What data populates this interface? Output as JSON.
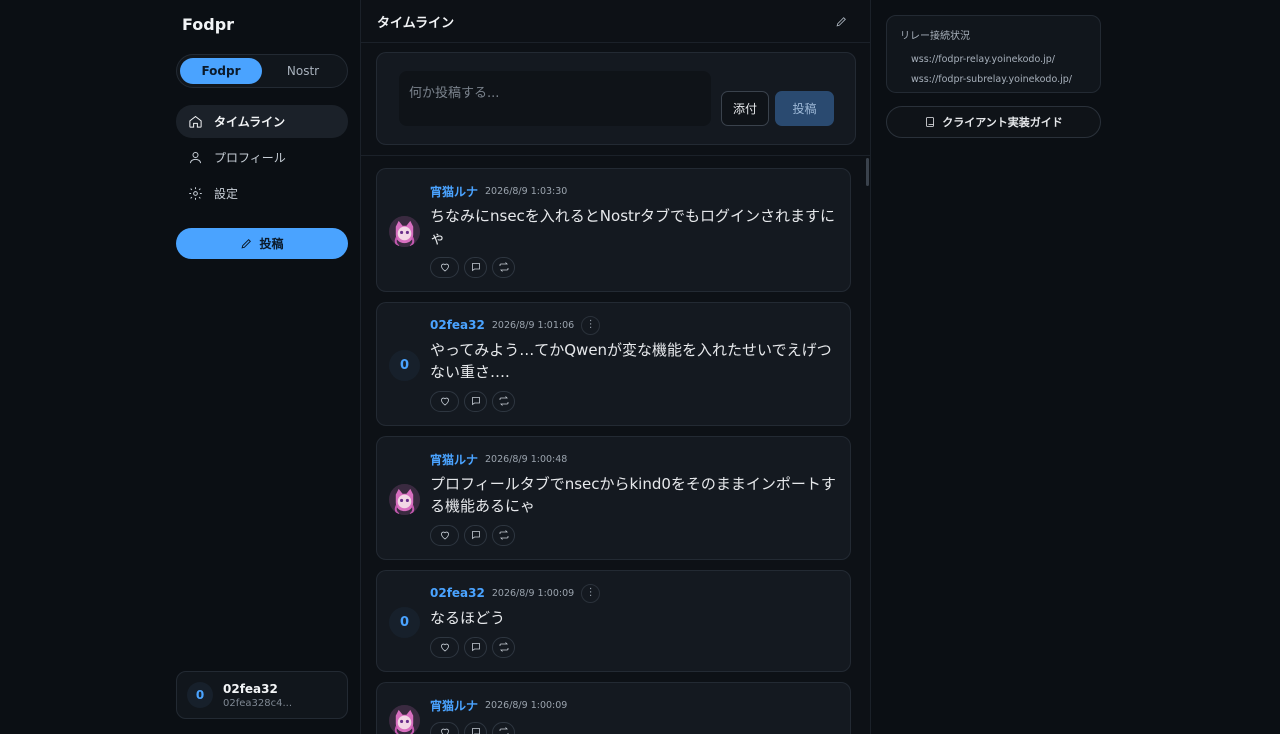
{
  "app": {
    "logo": "Fodpr"
  },
  "segments": [
    {
      "label": "Fodpr",
      "active": true
    },
    {
      "label": "Nostr",
      "active": false
    }
  ],
  "nav": [
    {
      "label": "タイムライン",
      "icon": "home-icon",
      "active": true
    },
    {
      "label": "プロフィール",
      "icon": "user-icon",
      "active": false
    },
    {
      "label": "設定",
      "icon": "gear-icon",
      "active": false
    }
  ],
  "post_button": {
    "label": "投稿",
    "icon": "pencil-icon"
  },
  "account": {
    "avatar_initial": "0",
    "name": "02fea32",
    "npub": "02fea328c4..."
  },
  "main": {
    "title": "タイムライン",
    "composer": {
      "placeholder": "何か投稿する...",
      "attach_label": "添付",
      "submit_label": "投稿"
    }
  },
  "posts": [
    {
      "author": "宵猫ルナ",
      "time": "2026/8/9 1:03:30",
      "avatar": "image",
      "avatar_initial": "",
      "has_menu": false,
      "content": "ちなみにnsecを入れるとNostrタブでもログインされますにゃ"
    },
    {
      "author": "02fea32",
      "time": "2026/8/9 1:01:06",
      "avatar": "initial",
      "avatar_initial": "0",
      "has_menu": true,
      "content": "やってみよう…てかQwenが変な機能を入れたせいでえげつない重さ…."
    },
    {
      "author": "宵猫ルナ",
      "time": "2026/8/9 1:00:48",
      "avatar": "image",
      "avatar_initial": "",
      "has_menu": false,
      "content": "プロフィールタブでnsecからkind0をそのままインポートする機能あるにゃ"
    },
    {
      "author": "02fea32",
      "time": "2026/8/9 1:00:09",
      "avatar": "initial",
      "avatar_initial": "0",
      "has_menu": true,
      "content": "なるほどう"
    },
    {
      "author": "宵猫ルナ",
      "time": "2026/8/9 1:00:09",
      "avatar": "image",
      "avatar_initial": "",
      "has_menu": false,
      "content": ""
    }
  ],
  "right": {
    "relay_title": "リレー接続状況",
    "relays": [
      "wss://fodpr-relay.yoinekodo.jp/",
      "wss://fodpr-subrelay.yoinekodo.jp/"
    ],
    "guide_label": "クライアント実装ガイド"
  },
  "colors": {
    "accent": "#4aa3ff",
    "background": "#0b0f14",
    "card": "#141920"
  }
}
